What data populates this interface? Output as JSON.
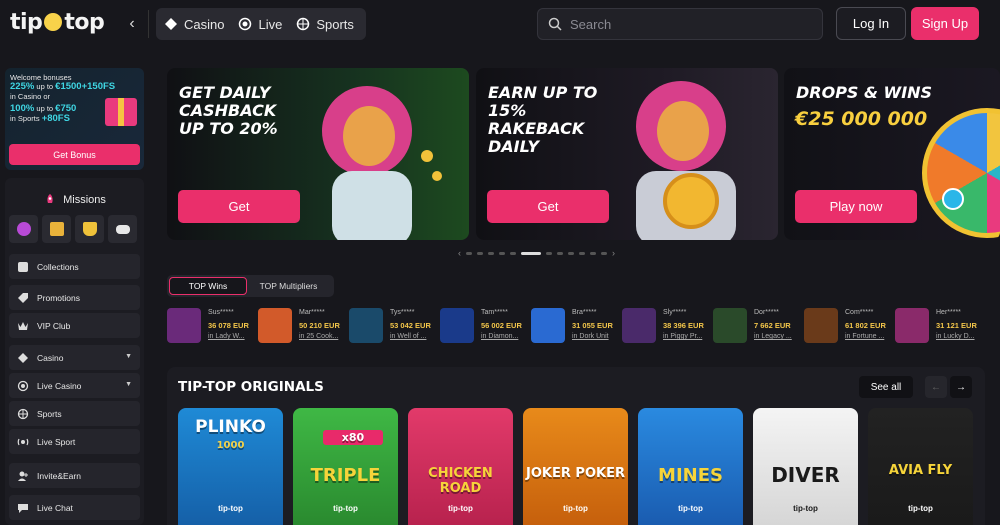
{
  "header": {
    "logo": "tip top",
    "nav": [
      {
        "label": "Casino",
        "icon": "casino-icon"
      },
      {
        "label": "Live",
        "icon": "live-icon"
      },
      {
        "label": "Sports",
        "icon": "sports-icon"
      }
    ],
    "search_placeholder": "Search",
    "login_label": "Log In",
    "signup_label": "Sign Up"
  },
  "sidebar": {
    "bonus": {
      "line1": "Welcome bonuses",
      "line2_hl": "225%",
      "line2_rest": " up to ",
      "line2_amt": "€1500+150FS",
      "line3": "in Casino or",
      "line4_hl": "100%",
      "line4_rest": " up to ",
      "line4_amt": "€750",
      "line5": "in Sports ",
      "line5_amt": "+80FS",
      "button": "Get Bonus"
    },
    "missions_label": "Missions",
    "items": [
      {
        "label": "Collections",
        "icon": "collections-icon"
      },
      {
        "label": "Promotions",
        "icon": "promotions-icon"
      },
      {
        "label": "VIP Club",
        "icon": "crown-icon"
      },
      {
        "label": "Casino",
        "icon": "casino-icon"
      },
      {
        "label": "Live Casino",
        "icon": "live-casino-icon"
      },
      {
        "label": "Sports",
        "icon": "sports-icon"
      },
      {
        "label": "Live Sport",
        "icon": "live-sport-icon"
      },
      {
        "label": "Invite&Earn",
        "icon": "invite-icon"
      },
      {
        "label": "Live Chat",
        "icon": "chat-icon"
      }
    ]
  },
  "banners": [
    {
      "title": "GET DAILY CASHBACK UP TO 20%",
      "button": "Get"
    },
    {
      "title": "EARN UP TO 15% RAKEBACK DAILY",
      "button": "Get"
    },
    {
      "title": "DROPS & WINS",
      "amount": "€25 000 000",
      "button": "Play now"
    }
  ],
  "win_tabs": {
    "active": "TOP Wins",
    "inactive": "TOP Multipliers"
  },
  "wins": [
    {
      "user": "Sus*****",
      "amount": "36 078 EUR",
      "game": "in Lady W...",
      "color": "#6a2a7a"
    },
    {
      "user": "Mar*****",
      "amount": "50 210 EUR",
      "game": "in 25 Cook...",
      "color": "#d25a2a"
    },
    {
      "user": "Tys*****",
      "amount": "53 042 EUR",
      "game": "in Well of ...",
      "color": "#1a4a6a"
    },
    {
      "user": "Tam*****",
      "amount": "56 002 EUR",
      "game": "in Diamon...",
      "color": "#1a3a8a"
    },
    {
      "user": "Bra*****",
      "amount": "31 055 EUR",
      "game": "in Dork Unit",
      "color": "#2a6ad2"
    },
    {
      "user": "Sly*****",
      "amount": "38 396 EUR",
      "game": "in Piggy Pr...",
      "color": "#4a2a6a"
    },
    {
      "user": "Dor*****",
      "amount": "7 662 EUR",
      "game": "in Legacy ...",
      "color": "#2a4a2a"
    },
    {
      "user": "Com*****",
      "amount": "61 802 EUR",
      "game": "in Fortune ...",
      "color": "#6a3a1a"
    },
    {
      "user": "Her*****",
      "amount": "31 121 EUR",
      "game": "in Lucky D...",
      "color": "#8a2a6a"
    }
  ],
  "originals": {
    "title": "TIP-TOP ORIGINALS",
    "see_all": "See all",
    "brand": "tip-top",
    "games": [
      {
        "name": "PLINKO",
        "sub": "1000",
        "color": "#1f8ad6"
      },
      {
        "name": "TRIPLE",
        "sub": "x80",
        "color": "#3fb845"
      },
      {
        "name": "CHICKEN ROAD",
        "sub": "",
        "color": "#e23a6a"
      },
      {
        "name": "JOKER POKER",
        "sub": "",
        "color": "#e88a1a"
      },
      {
        "name": "MINES",
        "sub": "",
        "color": "#2a8ae0"
      },
      {
        "name": "DIVER",
        "sub": "",
        "color": "#f0f0f0"
      },
      {
        "name": "AVIA FLY",
        "sub": "",
        "color": "#e02a3a"
      }
    ]
  }
}
